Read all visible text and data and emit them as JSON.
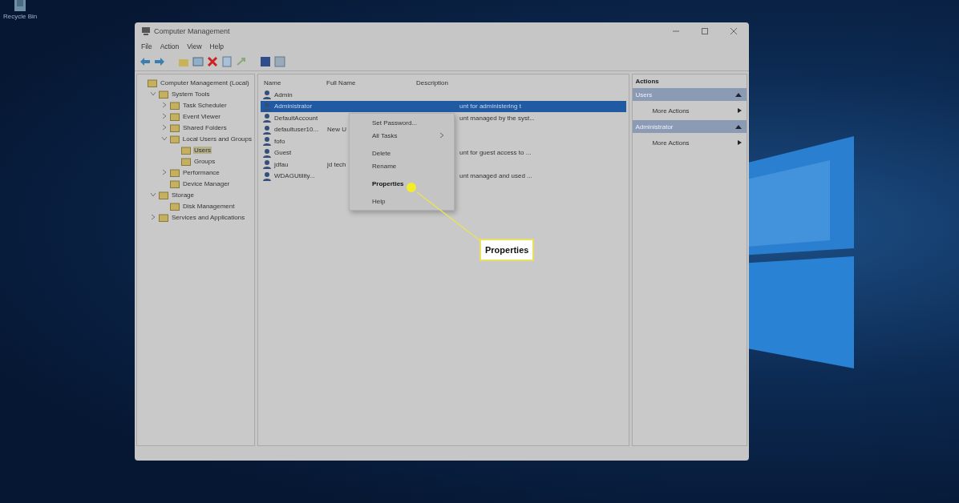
{
  "desktop": {
    "icons": [
      {
        "label": "Recycle Bin"
      }
    ]
  },
  "window": {
    "title": "Computer Management"
  },
  "menu_bar": [
    "File",
    "Action",
    "View",
    "Help"
  ],
  "tree": [
    {
      "label": "Computer Management (Local)",
      "selected": false,
      "children": [
        {
          "label": "System Tools",
          "selected": false,
          "expanded": true,
          "children": [
            {
              "label": "Task Scheduler",
              "selected": false,
              "expanded": false
            },
            {
              "label": "Event Viewer",
              "selected": false,
              "expanded": false
            },
            {
              "label": "Shared Folders",
              "selected": false,
              "expanded": false
            },
            {
              "label": "Local Users and Groups",
              "selected": false,
              "expanded": true,
              "children": [
                {
                  "label": "Users",
                  "selected": true
                },
                {
                  "label": "Groups",
                  "selected": false
                }
              ]
            },
            {
              "label": "Performance",
              "selected": false,
              "expanded": false
            },
            {
              "label": "Device Manager",
              "selected": false
            }
          ]
        },
        {
          "label": "Storage",
          "selected": false,
          "expanded": true,
          "children": [
            {
              "label": "Disk Management",
              "selected": false
            }
          ]
        },
        {
          "label": "Services and Applications",
          "selected": false,
          "expanded": false
        }
      ]
    }
  ],
  "table": {
    "columns": [
      "Name",
      "Full Name",
      "Description"
    ],
    "rows": [
      {
        "name": "Admin",
        "full_name": "",
        "description": "",
        "selected": false
      },
      {
        "name": "Administrator",
        "full_name": "",
        "description": "unt for administering t",
        "selected": true
      },
      {
        "name": "DefaultAccount",
        "full_name": "",
        "description": "unt managed by the syst...",
        "selected": false
      },
      {
        "name": "defaultuser10...",
        "full_name": "New U",
        "description": "",
        "selected": false
      },
      {
        "name": "fofo",
        "full_name": "",
        "description": "",
        "selected": false
      },
      {
        "name": "Guest",
        "full_name": "",
        "description": "unt for guest access to ...",
        "selected": false
      },
      {
        "name": "jdfau",
        "full_name": "jd tech",
        "description": "",
        "selected": false
      },
      {
        "name": "WDAGUtility...",
        "full_name": "",
        "description": "unt managed and used ...",
        "selected": false
      }
    ]
  },
  "context_menu": {
    "groups": [
      [
        {
          "label": "Set Password...",
          "bold": false,
          "submenu": false
        },
        {
          "label": "All Tasks",
          "bold": false,
          "submenu": true
        }
      ],
      [
        {
          "label": "Delete",
          "bold": false,
          "submenu": false
        },
        {
          "label": "Rename",
          "bold": false,
          "submenu": false
        }
      ],
      [
        {
          "label": "Properties",
          "bold": true,
          "submenu": false
        }
      ],
      [
        {
          "label": "Help",
          "bold": false,
          "submenu": false
        }
      ]
    ]
  },
  "actions": {
    "title": "Actions",
    "sections": [
      {
        "header": "Users",
        "items": [
          "More Actions"
        ]
      },
      {
        "header": "Administrator",
        "items": [
          "More Actions"
        ]
      }
    ]
  },
  "callout": {
    "label": "Properties"
  }
}
